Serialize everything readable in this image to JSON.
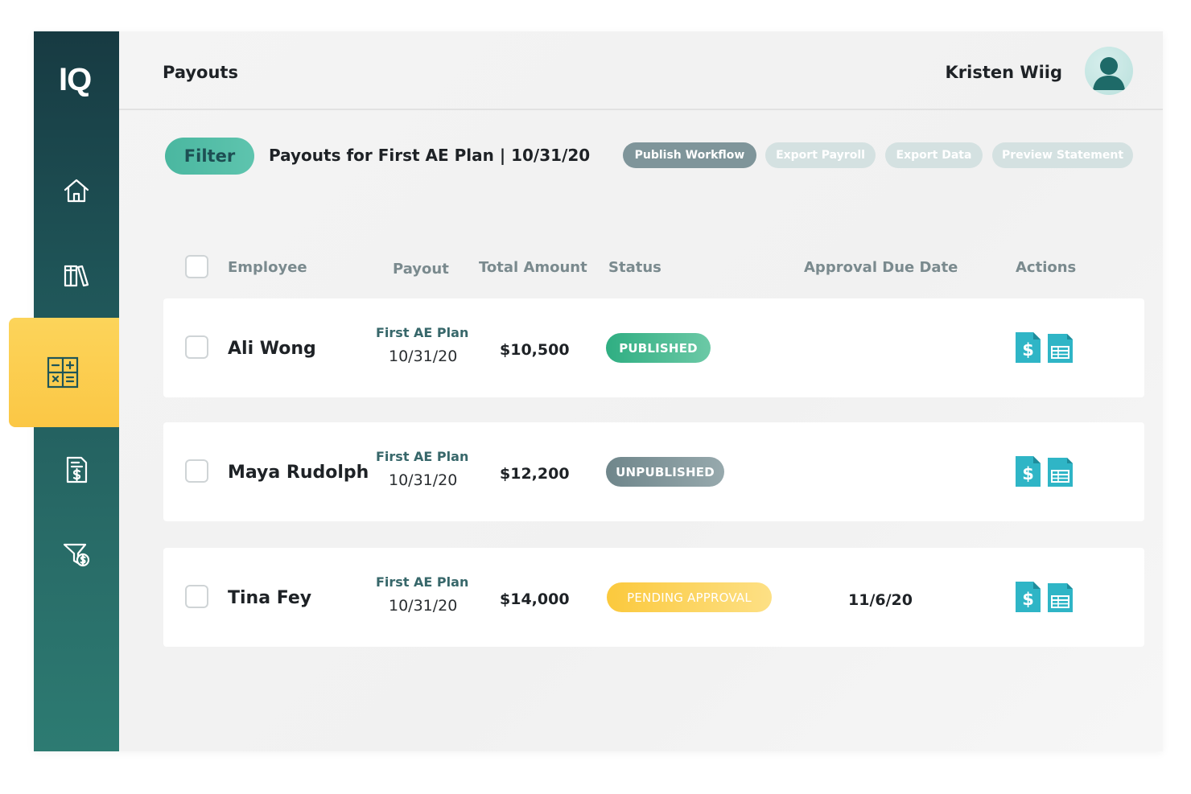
{
  "app": {
    "logo": "IQ"
  },
  "colors": {
    "sidebar_top": "#173a42",
    "sidebar_bottom": "#2d7b72",
    "active_nav": "#fbc745",
    "teal_accent": "#4ab7a0",
    "published": "#2fae82",
    "unpublished": "#7f959a",
    "pending": "#fbc93d"
  },
  "sidebar": {
    "items": [
      {
        "name": "home",
        "icon": "home-icon",
        "active": false
      },
      {
        "name": "library",
        "icon": "library-icon",
        "active": false
      },
      {
        "name": "calculator",
        "icon": "calculator-icon",
        "active": true
      },
      {
        "name": "statement",
        "icon": "document-dollar-icon",
        "active": false
      },
      {
        "name": "funnel",
        "icon": "funnel-dollar-icon",
        "active": false
      }
    ]
  },
  "header": {
    "title": "Payouts",
    "user_name": "Kristen Wiig",
    "avatar_icon": "user-avatar-icon"
  },
  "toolbar": {
    "filter_label": "Filter",
    "subtitle": "Payouts for First AE Plan | 10/31/20",
    "publish_workflow": "Publish Workflow",
    "export_payroll": "Export Payroll",
    "export_data": "Export Data",
    "preview_statement": "Preview Statement"
  },
  "table": {
    "columns": {
      "employee": "Employee",
      "payout": "Payout",
      "total_amount": "Total Amount",
      "status": "Status",
      "approval_due_date": "Approval Due Date",
      "actions": "Actions"
    },
    "rows": [
      {
        "employee": "Ali Wong",
        "plan": "First AE Plan",
        "date": "10/31/20",
        "amount": "$10,500",
        "status": "PUBLISHED",
        "due_date": ""
      },
      {
        "employee": "Maya Rudolph",
        "plan": "First AE Plan",
        "date": "10/31/20",
        "amount": "$12,200",
        "status": "UNPUBLISHED",
        "due_date": ""
      },
      {
        "employee": "Tina Fey",
        "plan": "First AE Plan",
        "date": "10/31/20",
        "amount": "$14,000",
        "status": "PENDING APPROVAL",
        "due_date": "11/6/20"
      }
    ],
    "action_icons": [
      "payout-dollar-icon",
      "spreadsheet-icon"
    ]
  }
}
